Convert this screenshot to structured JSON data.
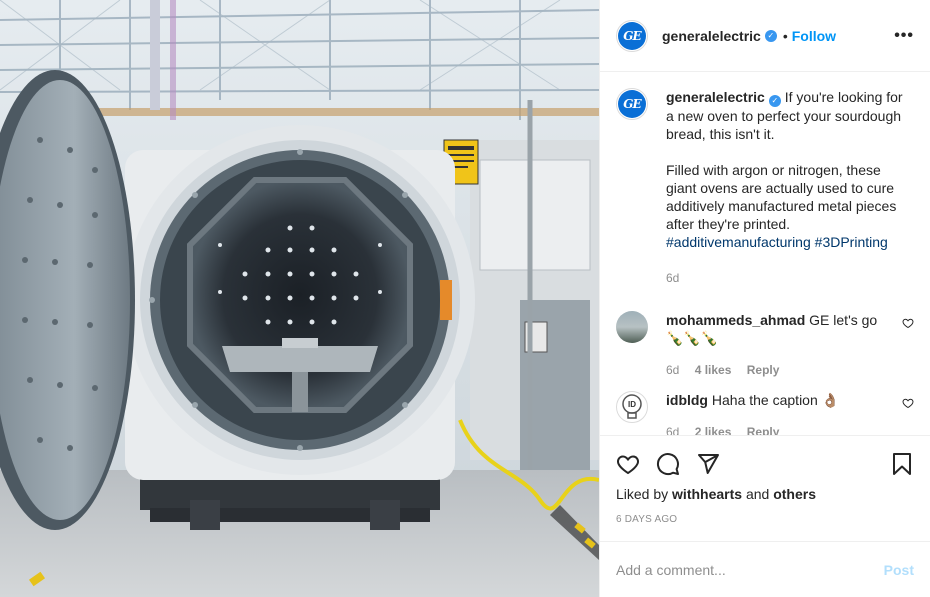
{
  "post": {
    "account": "generalelectric",
    "logo_text": "GE",
    "follow_label": "Follow",
    "separator": "•",
    "more_label": "•••",
    "verified_badge": "✓"
  },
  "caption": {
    "username": "generalelectric",
    "para1": "If you're looking for a new oven to perfect your sourdough bread, this isn't it.",
    "para2": "Filled with argon or nitrogen, these giant ovens are actually used to cure additively manufactured metal pieces after they're printed.",
    "hashtags": [
      "#additivemanufacturing",
      "#3DPrinting"
    ],
    "age": "6d"
  },
  "comments": [
    {
      "username": "mohammeds_ahmad",
      "text": "GE let's go",
      "emoji": "🍾🍾🍾",
      "age": "6d",
      "likes": "4 likes",
      "reply": "Reply"
    },
    {
      "username": "idbldg",
      "avatar_text": "ID",
      "text": "Haha the caption",
      "emoji": "👌🏽",
      "age": "6d",
      "likes": "2 likes",
      "reply": "Reply"
    }
  ],
  "engagement": {
    "liked_by_prefix": "Liked by",
    "liked_by_user": "withhearts",
    "liked_by_and": "and",
    "liked_by_others": "others",
    "date": "6 DAYS AGO"
  },
  "composer": {
    "placeholder": "Add a comment...",
    "post_label": "Post"
  },
  "icons": [
    "heart-icon",
    "comment-icon",
    "share-icon",
    "bookmark-icon",
    "more-icon"
  ],
  "colors": {
    "link": "#0095f6",
    "hashtag": "#00376b",
    "muted": "#8e8e8e",
    "post_disabled": "#b2dffc",
    "ge_blue": "#0a6fd6"
  }
}
